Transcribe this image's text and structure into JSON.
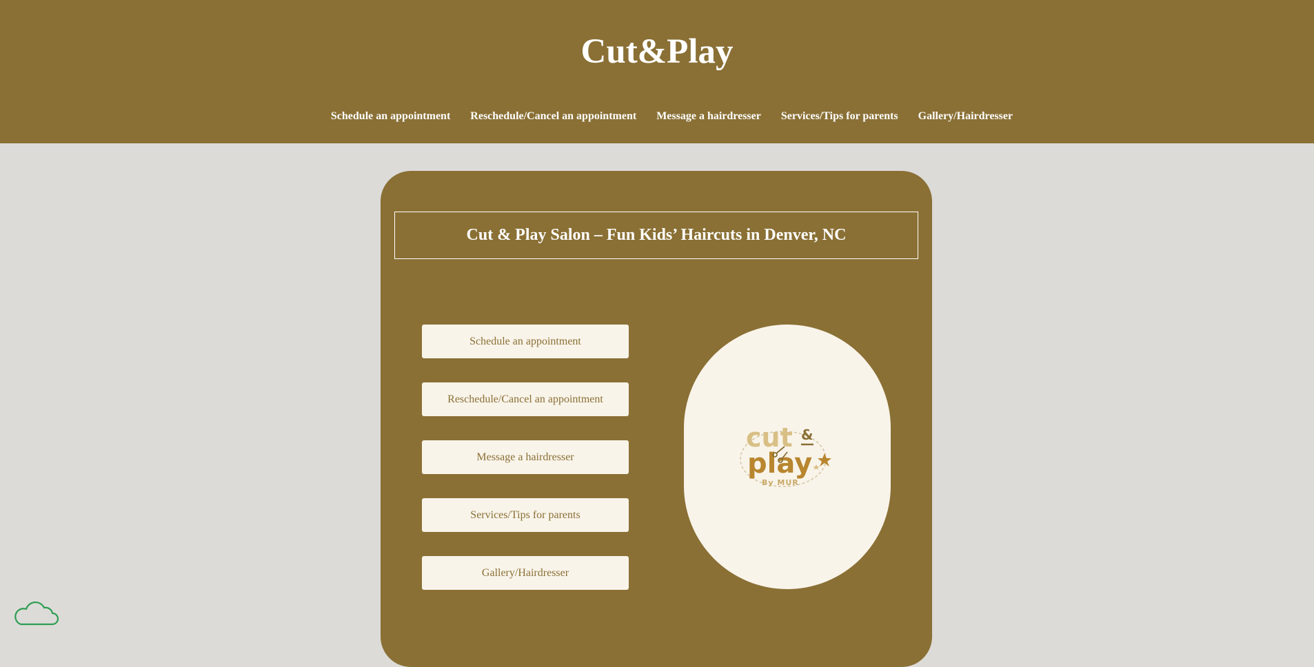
{
  "header": {
    "title": "Cut&Play",
    "nav": [
      {
        "label": "Schedule an appointment"
      },
      {
        "label": "Reschedule/Cancel an appointment"
      },
      {
        "label": "Message a hairdresser"
      },
      {
        "label": "Services/Tips for parents"
      },
      {
        "label": "Gallery/Hairdresser"
      }
    ]
  },
  "main": {
    "heading": "Cut & Play Salon – Fun Kids’ Haircuts in Denver, NC",
    "buttons": [
      {
        "label": "Schedule an appointment"
      },
      {
        "label": "Reschedule/Cancel an appointment"
      },
      {
        "label": "Message a hairdresser"
      },
      {
        "label": "Services/Tips for parents"
      },
      {
        "label": "Gallery/Hairdresser"
      }
    ],
    "logo": {
      "word1": "cut",
      "amp": "&",
      "word2": "play",
      "byline": "By MUR"
    }
  },
  "widget": {
    "icon": "cloud-icon"
  },
  "colors": {
    "brand": "#8a7035",
    "page_bg": "#dcdbd8",
    "button_bg": "#f9f4ea",
    "logo_light": "#d8bf85",
    "logo_dark": "#b8862f",
    "cloud": "#2e9d52"
  }
}
